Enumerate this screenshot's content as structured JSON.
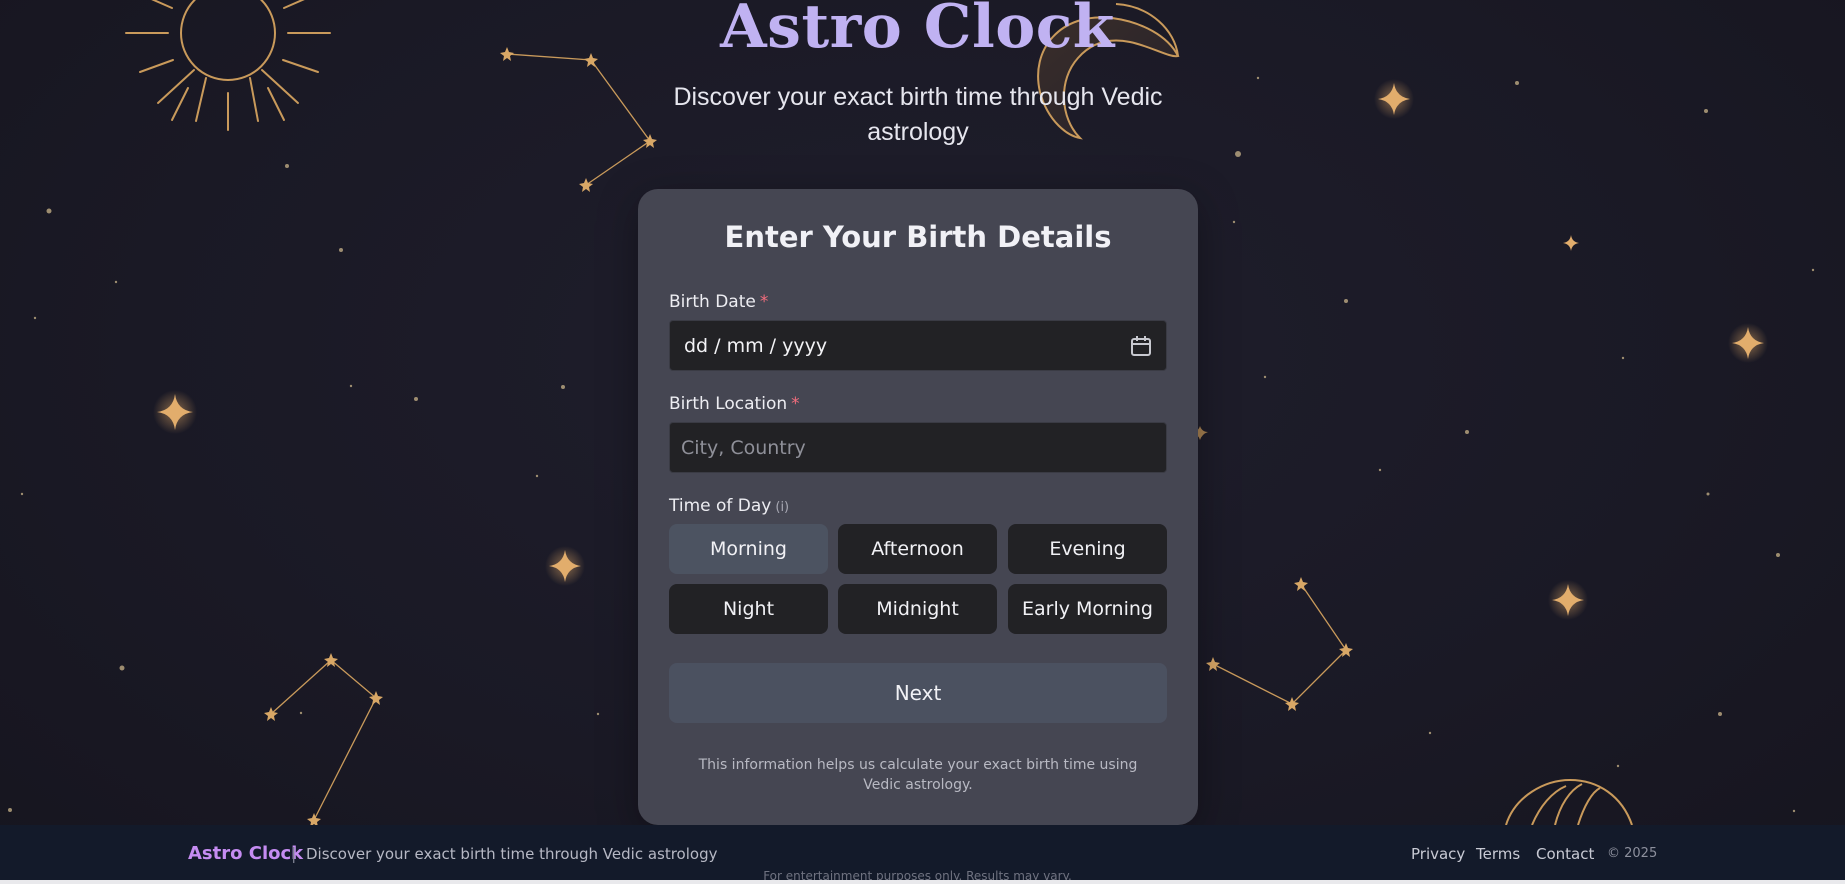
{
  "header": {
    "title": "Astro Clock",
    "subtitle": "Discover your exact birth time through Vedic astrology"
  },
  "form": {
    "heading": "Enter Your Birth Details",
    "birth_date": {
      "label": "Birth Date",
      "required": "*",
      "value": "dd / mm / yyyy"
    },
    "birth_location": {
      "label": "Birth Location",
      "required": "*",
      "placeholder": "City, Country"
    },
    "time_of_day": {
      "label": "Time of Day",
      "hint": "(i)",
      "options": [
        "Morning",
        "Afternoon",
        "Evening",
        "Night",
        "Midnight",
        "Early Morning"
      ],
      "selected": "Morning"
    },
    "next_label": "Next",
    "info": "This information helps us calculate your exact birth time using Vedic astrology."
  },
  "footer": {
    "brand": "Astro Clock",
    "separator": "|",
    "tagline": "Discover your exact birth time through Vedic astrology",
    "links": [
      "Privacy",
      "Terms",
      "Contact"
    ],
    "copyright": "© 2025",
    "disclaimer": "For entertainment purposes only. Results may vary."
  },
  "colors": {
    "background": "#1a1925",
    "card": "#454652",
    "field": "#222225",
    "selected_option": "#4c5361",
    "accent_gold": "#c99a5b",
    "title_lavender": "#c0b2f2",
    "brand_purple": "#c58cf2",
    "required_red": "#f26d7d",
    "footer": "#131a2a"
  },
  "icons": {
    "date_picker": "calendar-icon",
    "decorations": [
      "sun-icon",
      "crescent-moon-icon",
      "constellation-icon",
      "sparkle-star-icon",
      "planet-icon"
    ]
  }
}
